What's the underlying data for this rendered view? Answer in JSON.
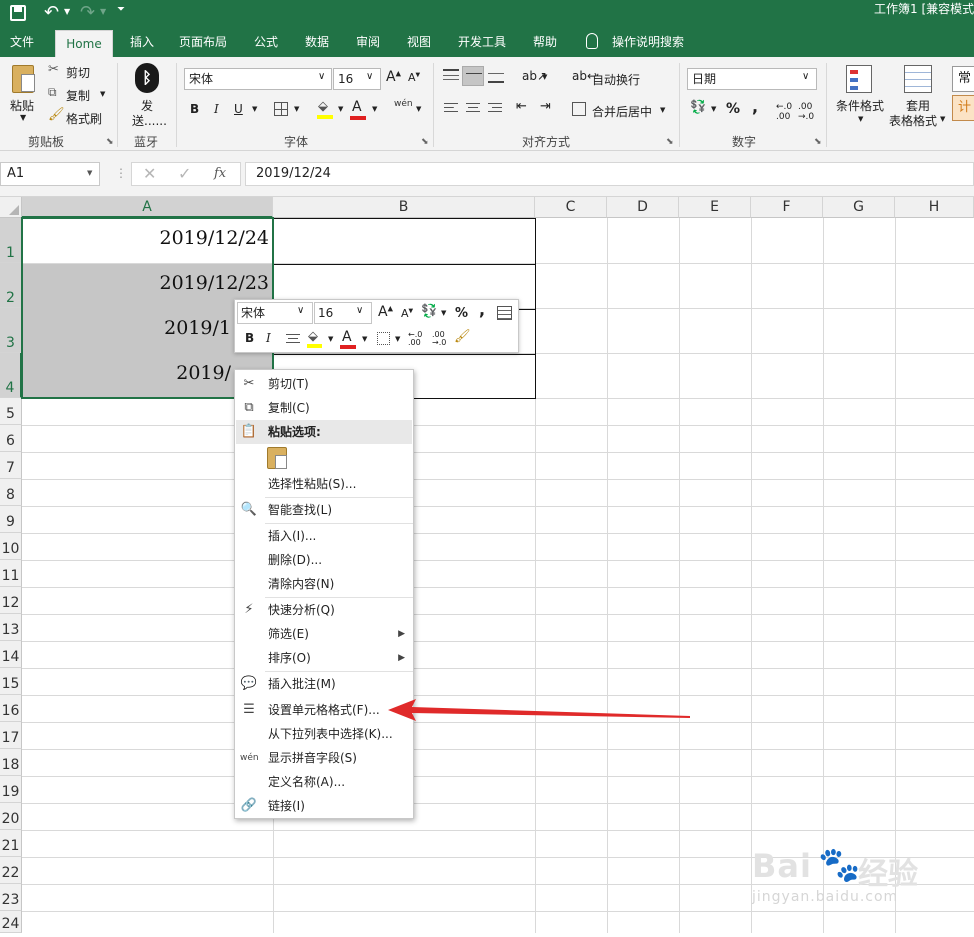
{
  "title": {
    "text": "工作簿1  [兼容模式"
  },
  "tabs": [
    "文件",
    "Home",
    "插入",
    "页面布局",
    "公式",
    "数据",
    "审阅",
    "视图",
    "开发工具",
    "帮助"
  ],
  "tell_me": "操作说明搜索",
  "clipboard": {
    "paste": "粘贴",
    "cut": "剪切",
    "copy": "复制",
    "format_painter": "格式刷",
    "label": "剪贴板"
  },
  "bluetooth": {
    "send_line1": "发",
    "send_line2": "送......",
    "label": "蓝牙"
  },
  "font": {
    "name": "宋体",
    "size": "16",
    "bold": "B",
    "italic": "I",
    "underline": "U",
    "phonetic": "wén",
    "label": "字体"
  },
  "alignment": {
    "wrap": "自动换行",
    "merge": "合并后居中",
    "label": "对齐方式"
  },
  "number": {
    "format": "日期",
    "percent": "%",
    "comma": ",",
    "label": "数字"
  },
  "styles": {
    "conditional": "条件格式",
    "table_line1": "套用",
    "table_line2": "表格格式",
    "normal": "常",
    "calc": "计"
  },
  "formula_bar": {
    "name_box": "A1",
    "fx": "fx",
    "value": "2019/12/24"
  },
  "columns": [
    "A",
    "B",
    "C",
    "D",
    "E",
    "F",
    "G",
    "H"
  ],
  "rows": [
    "1",
    "2",
    "3",
    "4",
    "5",
    "6",
    "7",
    "8",
    "9",
    "10",
    "11",
    "12",
    "13",
    "14",
    "15",
    "16",
    "17",
    "18",
    "19",
    "20",
    "21",
    "22",
    "23",
    "24"
  ],
  "cells": {
    "a1": "2019/12/24",
    "a2": "2019/12/23",
    "a3": "2019/1",
    "a4": "2019/"
  },
  "mini_toolbar": {
    "font": "宋体",
    "size": "16",
    "percent": "%",
    "comma": ",",
    "bold": "B",
    "italic": "I"
  },
  "context_menu": {
    "cut": "剪切(T)",
    "copy": "复制(C)",
    "paste_options": "粘贴选项:",
    "paste_special": "选择性粘贴(S)...",
    "smart_lookup": "智能查找(L)",
    "insert": "插入(I)...",
    "delete": "删除(D)...",
    "clear": "清除内容(N)",
    "quick_analysis": "快速分析(Q)",
    "filter": "筛选(E)",
    "sort": "排序(O)",
    "insert_comment": "插入批注(M)",
    "format_cells": "设置单元格格式(F)...",
    "pick_from_list": "从下拉列表中选择(K)...",
    "phonetic": "显示拼音字段(S)",
    "define_name": "定义名称(A)...",
    "link": "链接(I)"
  },
  "watermark": {
    "brand": "Bai",
    "brand_cn": "经验",
    "url": "jingyan.baidu.com"
  },
  "colors": {
    "excel_green": "#217346",
    "selection_fill": "#c6c6c6",
    "arrow_red": "#e02a2a"
  }
}
